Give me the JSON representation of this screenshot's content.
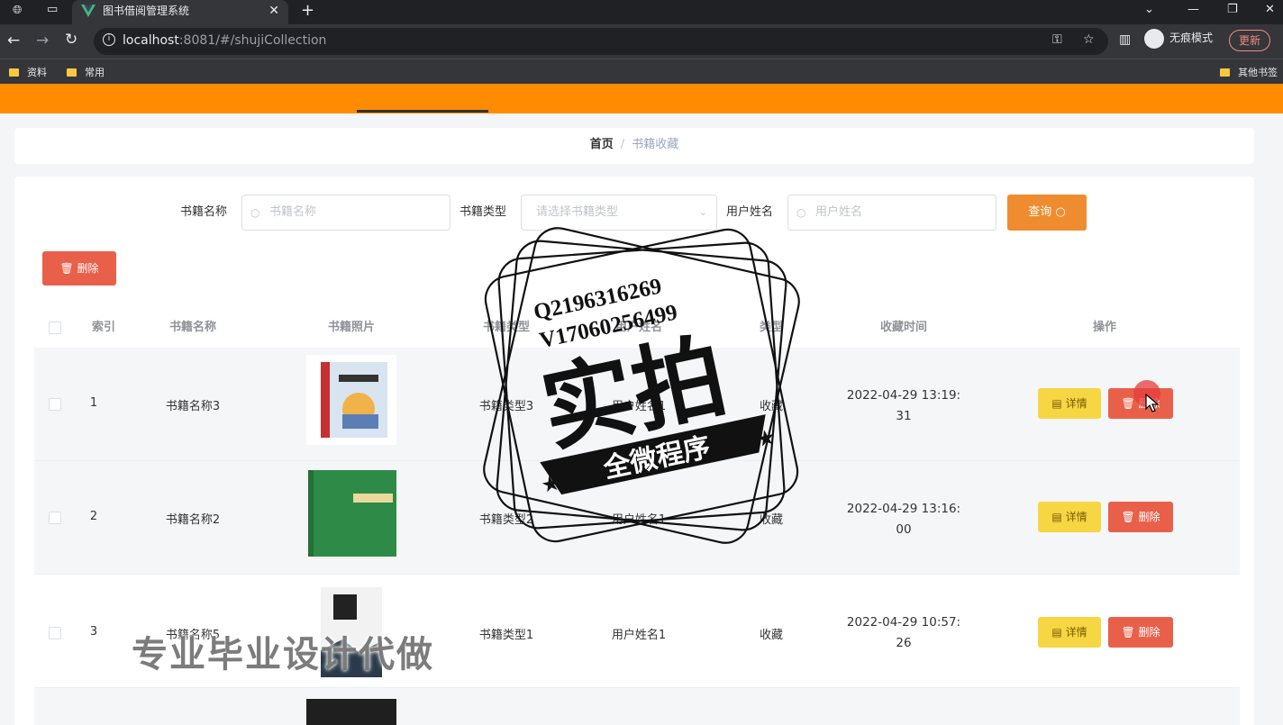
{
  "browser": {
    "tab_title": "图书借阅管理系统",
    "tab_close": "✕",
    "new_tab": "+",
    "url_host": "localhost",
    "url_path": ":8081/#/shujiCollection",
    "incognito_label": "无痕模式",
    "update_label": "更新",
    "bookmarks": [
      "资料",
      "常用"
    ],
    "other_bookmarks": "其他书签"
  },
  "breadcrumb": {
    "home": "首页",
    "separator": "/",
    "current": "书籍收藏"
  },
  "search": {
    "book_name_label": "书籍名称",
    "book_name_placeholder": "书籍名称",
    "book_type_label": "书籍类型",
    "book_type_placeholder": "请选择书籍类型",
    "user_name_label": "用户姓名",
    "user_name_placeholder": "用户姓名",
    "query_label": "查询"
  },
  "toolbar": {
    "delete_label": "删除"
  },
  "table": {
    "headers": {
      "index": "索引",
      "name": "书籍名称",
      "photo": "书籍照片",
      "type": "书籍类型",
      "user": "用户姓名",
      "kind": "类型",
      "time": "收藏时间",
      "ops": "操作"
    },
    "rows": [
      {
        "index": "1",
        "name": "书籍名称3",
        "type": "书籍类型3",
        "user": "用户姓名1",
        "kind": "收藏",
        "time_line1": "2022-04-29 13:19:",
        "time_line2": "31",
        "cover_color": "#d8e4f0"
      },
      {
        "index": "2",
        "name": "书籍名称2",
        "type": "书籍类型2",
        "user": "用户姓名1",
        "kind": "收藏",
        "time_line1": "2022-04-29 13:16:",
        "time_line2": "00",
        "cover_color": "#2e8b47"
      },
      {
        "index": "3",
        "name": "书籍名称5",
        "type": "书籍类型1",
        "user": "用户姓名1",
        "kind": "收藏",
        "time_line1": "2022-04-29 10:57:",
        "time_line2": "26",
        "cover_color": "#f2f2f2"
      }
    ],
    "detail_label": "详情",
    "delete_label": "删除"
  },
  "watermark": {
    "qq": "Q2196316269",
    "wx": "V17060256499",
    "big": "实拍",
    "banner": "全微程序",
    "bottom": "专业毕业设计代做"
  },
  "colors": {
    "nav": "#ff8c00",
    "query": "#f08c30",
    "delete": "#e9604a",
    "detail": "#f6d643"
  }
}
